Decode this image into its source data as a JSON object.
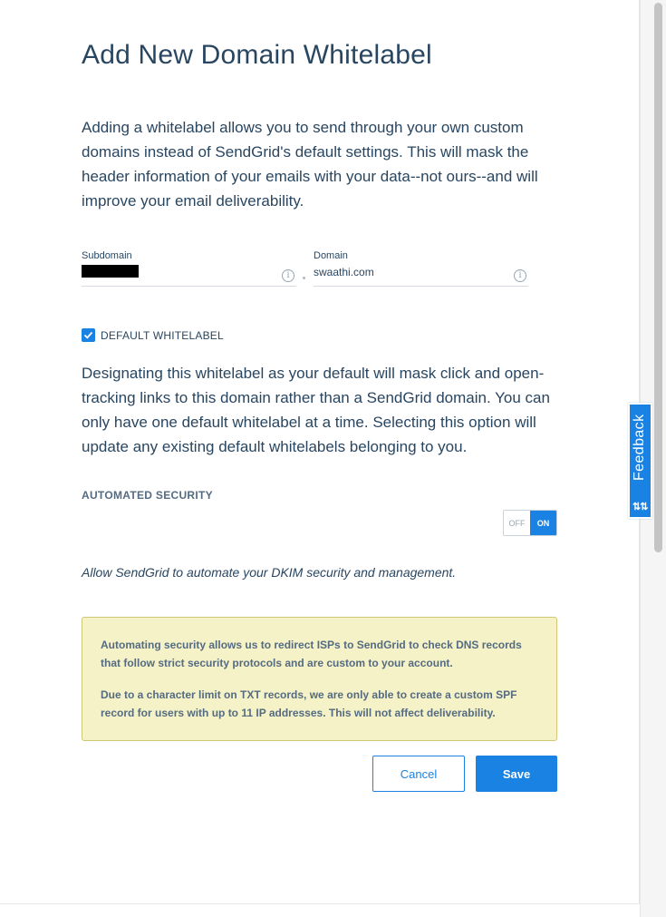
{
  "page": {
    "title": "Add New Domain Whitelabel",
    "intro": "Adding a whitelabel allows you to send through your own custom domains instead of SendGrid's default settings. This will mask the header information of your emails with your data--not ours--and will improve your email deliverability."
  },
  "form": {
    "subdomain_label": "Subdomain",
    "subdomain_value": "",
    "domain_label": "Domain",
    "domain_value": "swaathi.com",
    "default_checkbox_label": "DEFAULT WHITELABEL",
    "default_checked": true,
    "default_description": "Designating this whitelabel as your default will mask click and open-tracking links to this domain rather than a SendGrid domain. You can only have one default whitelabel at a time. Selecting this option will update any existing default whitelabels belonging to you.",
    "automated_security_heading": "AUTOMATED SECURITY",
    "toggle_off": "OFF",
    "toggle_on": "ON",
    "toggle_state": "on",
    "automated_security_note": "Allow SendGrid to automate your DKIM security and management.",
    "warning_p1": "Automating security allows us to redirect ISPs to SendGrid to check DNS records that follow strict security protocols and are custom to your account.",
    "warning_p2": "Due to a character limit on TXT records, we are only able to create a custom SPF record for users with up to 11 IP addresses. This will not affect deliverability."
  },
  "actions": {
    "cancel_label": "Cancel",
    "save_label": "Save"
  },
  "feedback": {
    "label": "Feedback",
    "icon": "sort-arrows-icon"
  },
  "colors": {
    "accent": "#1a82e2",
    "text": "#294661",
    "warning_bg": "#f5f2c8",
    "warning_border": "#cec873"
  }
}
